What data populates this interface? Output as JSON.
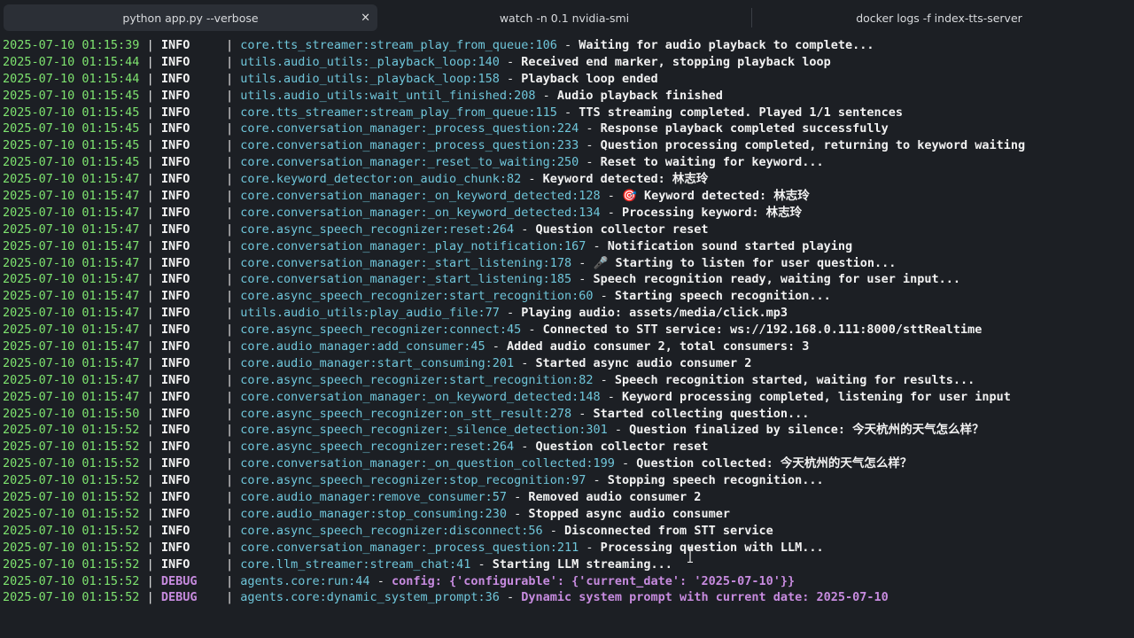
{
  "tabs": [
    {
      "label": "python app.py --verbose",
      "active": true,
      "close": "×"
    },
    {
      "label": "watch -n 0.1 nvidia-smi",
      "active": false
    },
    {
      "label": "docker logs -f index-tts-server",
      "active": false
    }
  ],
  "colors": {
    "timestamp": "#7ee36f",
    "source": "#6fc6da",
    "info": "#f2f2f2",
    "debug": "#c78bdf",
    "background": "#1c1f24"
  },
  "log_lines": [
    {
      "ts": "2025-07-10 01:15:39",
      "level": "INFO",
      "src": "core.tts_streamer:stream_play_from_queue:106",
      "msg": "Waiting for audio playback to complete..."
    },
    {
      "ts": "2025-07-10 01:15:44",
      "level": "INFO",
      "src": "utils.audio_utils:_playback_loop:140",
      "msg": "Received end marker, stopping playback loop"
    },
    {
      "ts": "2025-07-10 01:15:44",
      "level": "INFO",
      "src": "utils.audio_utils:_playback_loop:158",
      "msg": "Playback loop ended"
    },
    {
      "ts": "2025-07-10 01:15:45",
      "level": "INFO",
      "src": "utils.audio_utils:wait_until_finished:208",
      "msg": "Audio playback finished"
    },
    {
      "ts": "2025-07-10 01:15:45",
      "level": "INFO",
      "src": "core.tts_streamer:stream_play_from_queue:115",
      "msg": "TTS streaming completed. Played 1/1 sentences"
    },
    {
      "ts": "2025-07-10 01:15:45",
      "level": "INFO",
      "src": "core.conversation_manager:_process_question:224",
      "msg": "Response playback completed successfully"
    },
    {
      "ts": "2025-07-10 01:15:45",
      "level": "INFO",
      "src": "core.conversation_manager:_process_question:233",
      "msg": "Question processing completed, returning to keyword waiting"
    },
    {
      "ts": "2025-07-10 01:15:45",
      "level": "INFO",
      "src": "core.conversation_manager:_reset_to_waiting:250",
      "msg": "Reset to waiting for keyword..."
    },
    {
      "ts": "2025-07-10 01:15:47",
      "level": "INFO",
      "src": "core.keyword_detector:on_audio_chunk:82",
      "msg": "Keyword detected: 林志玲"
    },
    {
      "ts": "2025-07-10 01:15:47",
      "level": "INFO",
      "src": "core.conversation_manager:_on_keyword_detected:128",
      "msg": "🎯 Keyword detected: 林志玲"
    },
    {
      "ts": "2025-07-10 01:15:47",
      "level": "INFO",
      "src": "core.conversation_manager:_on_keyword_detected:134",
      "msg": "Processing keyword: 林志玲"
    },
    {
      "ts": "2025-07-10 01:15:47",
      "level": "INFO",
      "src": "core.async_speech_recognizer:reset:264",
      "msg": "Question collector reset"
    },
    {
      "ts": "2025-07-10 01:15:47",
      "level": "INFO",
      "src": "core.conversation_manager:_play_notification:167",
      "msg": "Notification sound started playing"
    },
    {
      "ts": "2025-07-10 01:15:47",
      "level": "INFO",
      "src": "core.conversation_manager:_start_listening:178",
      "msg": "🎤 Starting to listen for user question..."
    },
    {
      "ts": "2025-07-10 01:15:47",
      "level": "INFO",
      "src": "core.conversation_manager:_start_listening:185",
      "msg": "Speech recognition ready, waiting for user input..."
    },
    {
      "ts": "2025-07-10 01:15:47",
      "level": "INFO",
      "src": "core.async_speech_recognizer:start_recognition:60",
      "msg": "Starting speech recognition..."
    },
    {
      "ts": "2025-07-10 01:15:47",
      "level": "INFO",
      "src": "utils.audio_utils:play_audio_file:77",
      "msg": "Playing audio: assets/media/click.mp3"
    },
    {
      "ts": "2025-07-10 01:15:47",
      "level": "INFO",
      "src": "core.async_speech_recognizer:connect:45",
      "msg": "Connected to STT service: ws://192.168.0.111:8000/sttRealtime"
    },
    {
      "ts": "2025-07-10 01:15:47",
      "level": "INFO",
      "src": "core.audio_manager:add_consumer:45",
      "msg": "Added audio consumer 2, total consumers: 3"
    },
    {
      "ts": "2025-07-10 01:15:47",
      "level": "INFO",
      "src": "core.audio_manager:start_consuming:201",
      "msg": "Started async audio consumer 2"
    },
    {
      "ts": "2025-07-10 01:15:47",
      "level": "INFO",
      "src": "core.async_speech_recognizer:start_recognition:82",
      "msg": "Speech recognition started, waiting for results..."
    },
    {
      "ts": "2025-07-10 01:15:47",
      "level": "INFO",
      "src": "core.conversation_manager:_on_keyword_detected:148",
      "msg": "Keyword processing completed, listening for user input"
    },
    {
      "ts": "2025-07-10 01:15:50",
      "level": "INFO",
      "src": "core.async_speech_recognizer:on_stt_result:278",
      "msg": "Started collecting question..."
    },
    {
      "ts": "2025-07-10 01:15:52",
      "level": "INFO",
      "src": "core.async_speech_recognizer:_silence_detection:301",
      "msg": "Question finalized by silence: 今天杭州的天气怎么样？"
    },
    {
      "ts": "2025-07-10 01:15:52",
      "level": "INFO",
      "src": "core.async_speech_recognizer:reset:264",
      "msg": "Question collector reset"
    },
    {
      "ts": "2025-07-10 01:15:52",
      "level": "INFO",
      "src": "core.conversation_manager:_on_question_collected:199",
      "msg": "Question collected: 今天杭州的天气怎么样？"
    },
    {
      "ts": "2025-07-10 01:15:52",
      "level": "INFO",
      "src": "core.async_speech_recognizer:stop_recognition:97",
      "msg": "Stopping speech recognition..."
    },
    {
      "ts": "2025-07-10 01:15:52",
      "level": "INFO",
      "src": "core.audio_manager:remove_consumer:57",
      "msg": "Removed audio consumer 2"
    },
    {
      "ts": "2025-07-10 01:15:52",
      "level": "INFO",
      "src": "core.audio_manager:stop_consuming:230",
      "msg": "Stopped async audio consumer"
    },
    {
      "ts": "2025-07-10 01:15:52",
      "level": "INFO",
      "src": "core.async_speech_recognizer:disconnect:56",
      "msg": "Disconnected from STT service"
    },
    {
      "ts": "2025-07-10 01:15:52",
      "level": "INFO",
      "src": "core.conversation_manager:_process_question:211",
      "msg": "Processing question with LLM..."
    },
    {
      "ts": "2025-07-10 01:15:52",
      "level": "INFO",
      "src": "core.llm_streamer:stream_chat:41",
      "msg": "Starting LLM streaming..."
    },
    {
      "ts": "2025-07-10 01:15:52",
      "level": "DEBUG",
      "src": "agents.core:run:44",
      "msg": "config: {'configurable': {'current_date': '2025-07-10'}}"
    },
    {
      "ts": "2025-07-10 01:15:52",
      "level": "DEBUG",
      "src": "agents.core:dynamic_system_prompt:36",
      "msg": "Dynamic system prompt with current date: 2025-07-10"
    }
  ]
}
